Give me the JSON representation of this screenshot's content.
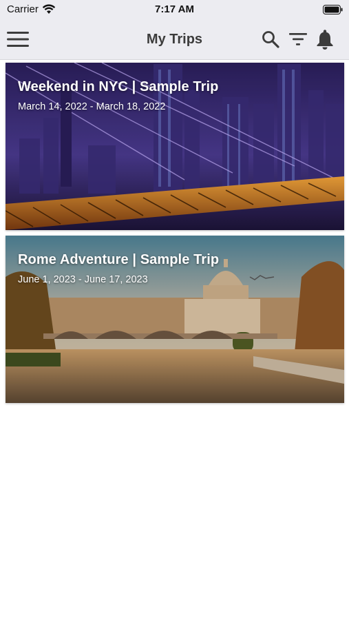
{
  "status_bar": {
    "carrier": "Carrier",
    "time": "7:17 AM",
    "icons": [
      "wifi-icon",
      "battery-icon"
    ]
  },
  "nav": {
    "title": "My Trips",
    "icons": [
      "menu-icon",
      "search-icon",
      "filter-icon",
      "bell-icon"
    ]
  },
  "trips": [
    {
      "title": "Weekend in NYC | Sample Trip",
      "dates": "March 14, 2022 - March 18, 2022"
    },
    {
      "title": "Rome Adventure | Sample Trip",
      "dates": "June 1, 2023 - June 17, 2023"
    }
  ],
  "colors": {
    "nav_bg": "#ececf1",
    "title_text": "#3c3c3c",
    "card_text": "#ffffff"
  }
}
